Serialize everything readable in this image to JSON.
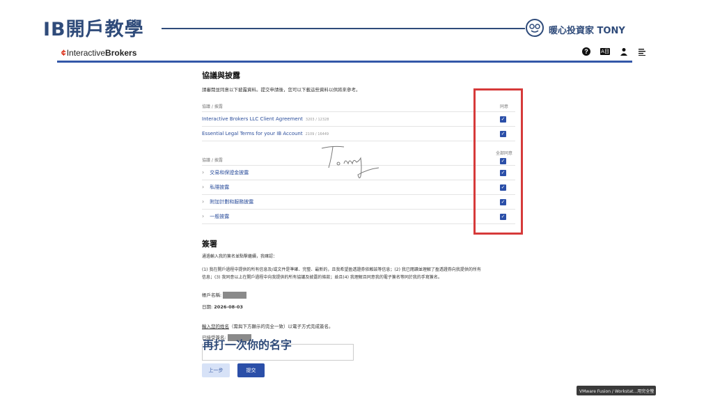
{
  "slide": {
    "title": "IB開戶教學",
    "brand": "暖心投資家 TONY"
  },
  "app": {
    "logo_mark": "¢",
    "logo_text_a": "Interactive",
    "logo_text_b": "Brokers",
    "icons": {
      "help": "?",
      "lang": "A目",
      "user": "user-icon",
      "menu": "menu-icon"
    }
  },
  "agreements": {
    "title": "協議與披露",
    "intro": "請審閱並同意以下披露資料。提交申請後，您可以下載這些資料以供將來參考。",
    "table1": {
      "header": "協議 / 披露",
      "agree_header": "同意",
      "rows": [
        {
          "label": "Interactive Brokers LLC Client Agreement",
          "count": "3203 / 12328"
        },
        {
          "label": "Essential Legal Terms for your IB Account",
          "count": "2109 / 16449"
        }
      ]
    },
    "table2": {
      "header": "協議 / 披露",
      "agree_all": "全部同意",
      "rows": [
        {
          "label": "交易和保證金披露"
        },
        {
          "label": "私隱披露"
        },
        {
          "label": "附加計劃和服務披露"
        },
        {
          "label": "一般披露"
        }
      ]
    }
  },
  "signature": {
    "title": "簽署",
    "intro": "通過輸入我的簽名並點擊繼續，我確認：",
    "confirm_line1": "(1) 我在開戶過程中提供的所有信息及/或文件是準確、完整、最新的，且我希望盈透證券依賴該等信息；(2) 我已閱讀並理解了盈透證券向我提供的所有",
    "confirm_line2": "信息；(3) 我同意以上在開戶過程中向我提供的所有協議及披露的條款；並且(4) 我理解且同意我的電子簽名等同於我的手寫簽名。",
    "account_label": "帳戶名稱:",
    "date_label": "日期:",
    "date_value": "2026-08-03",
    "input_prompt_a": "輸入您的姓名",
    "input_prompt_b": "（需與下方顯示的完全一致）以電子方式完成簽名。",
    "accepted_label": "已接受簽名:",
    "overlay_note": "再打一次你的名字",
    "prev_button": "上一步",
    "submit_button": "提交"
  },
  "tooltip": "VMware Fusion / Workstat...用完全螢"
}
